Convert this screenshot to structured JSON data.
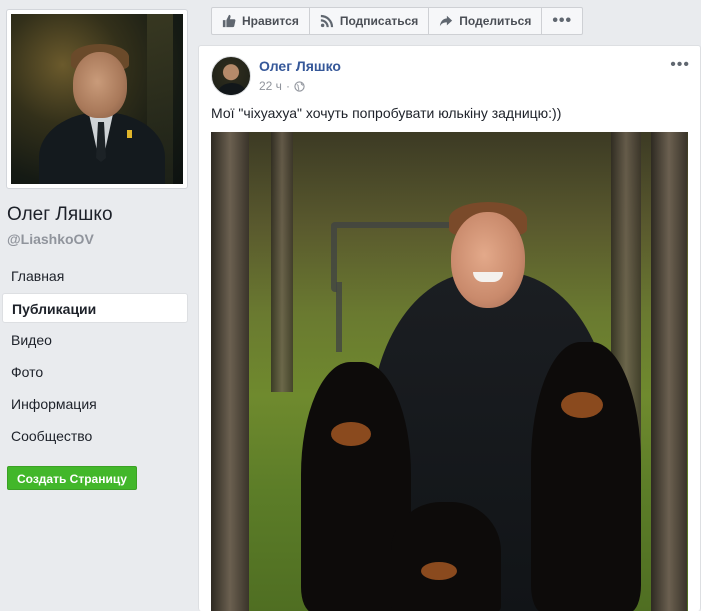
{
  "page": {
    "name": "Олег Ляшко",
    "handle": "@LiashkoOV"
  },
  "nav": {
    "items": [
      {
        "label": "Главная",
        "active": false
      },
      {
        "label": "Публикации",
        "active": true
      },
      {
        "label": "Видео",
        "active": false
      },
      {
        "label": "Фото",
        "active": false
      },
      {
        "label": "Информация",
        "active": false
      },
      {
        "label": "Сообщество",
        "active": false
      }
    ],
    "create_page_label": "Создать Страницу"
  },
  "actions": {
    "like_label": "Нравится",
    "subscribe_label": "Подписаться",
    "share_label": "Поделиться",
    "more_icon": "ellipsis-icon"
  },
  "post": {
    "author": "Олег Ляшко",
    "time": "22 ч",
    "audience_icon": "globe-icon",
    "text": "Мої \"чіхуахуа\" хочуть попробувати юлькіну задницю:))"
  },
  "colors": {
    "link": "#365899",
    "create_button": "#42b72a",
    "page_background": "#e9ebee"
  }
}
